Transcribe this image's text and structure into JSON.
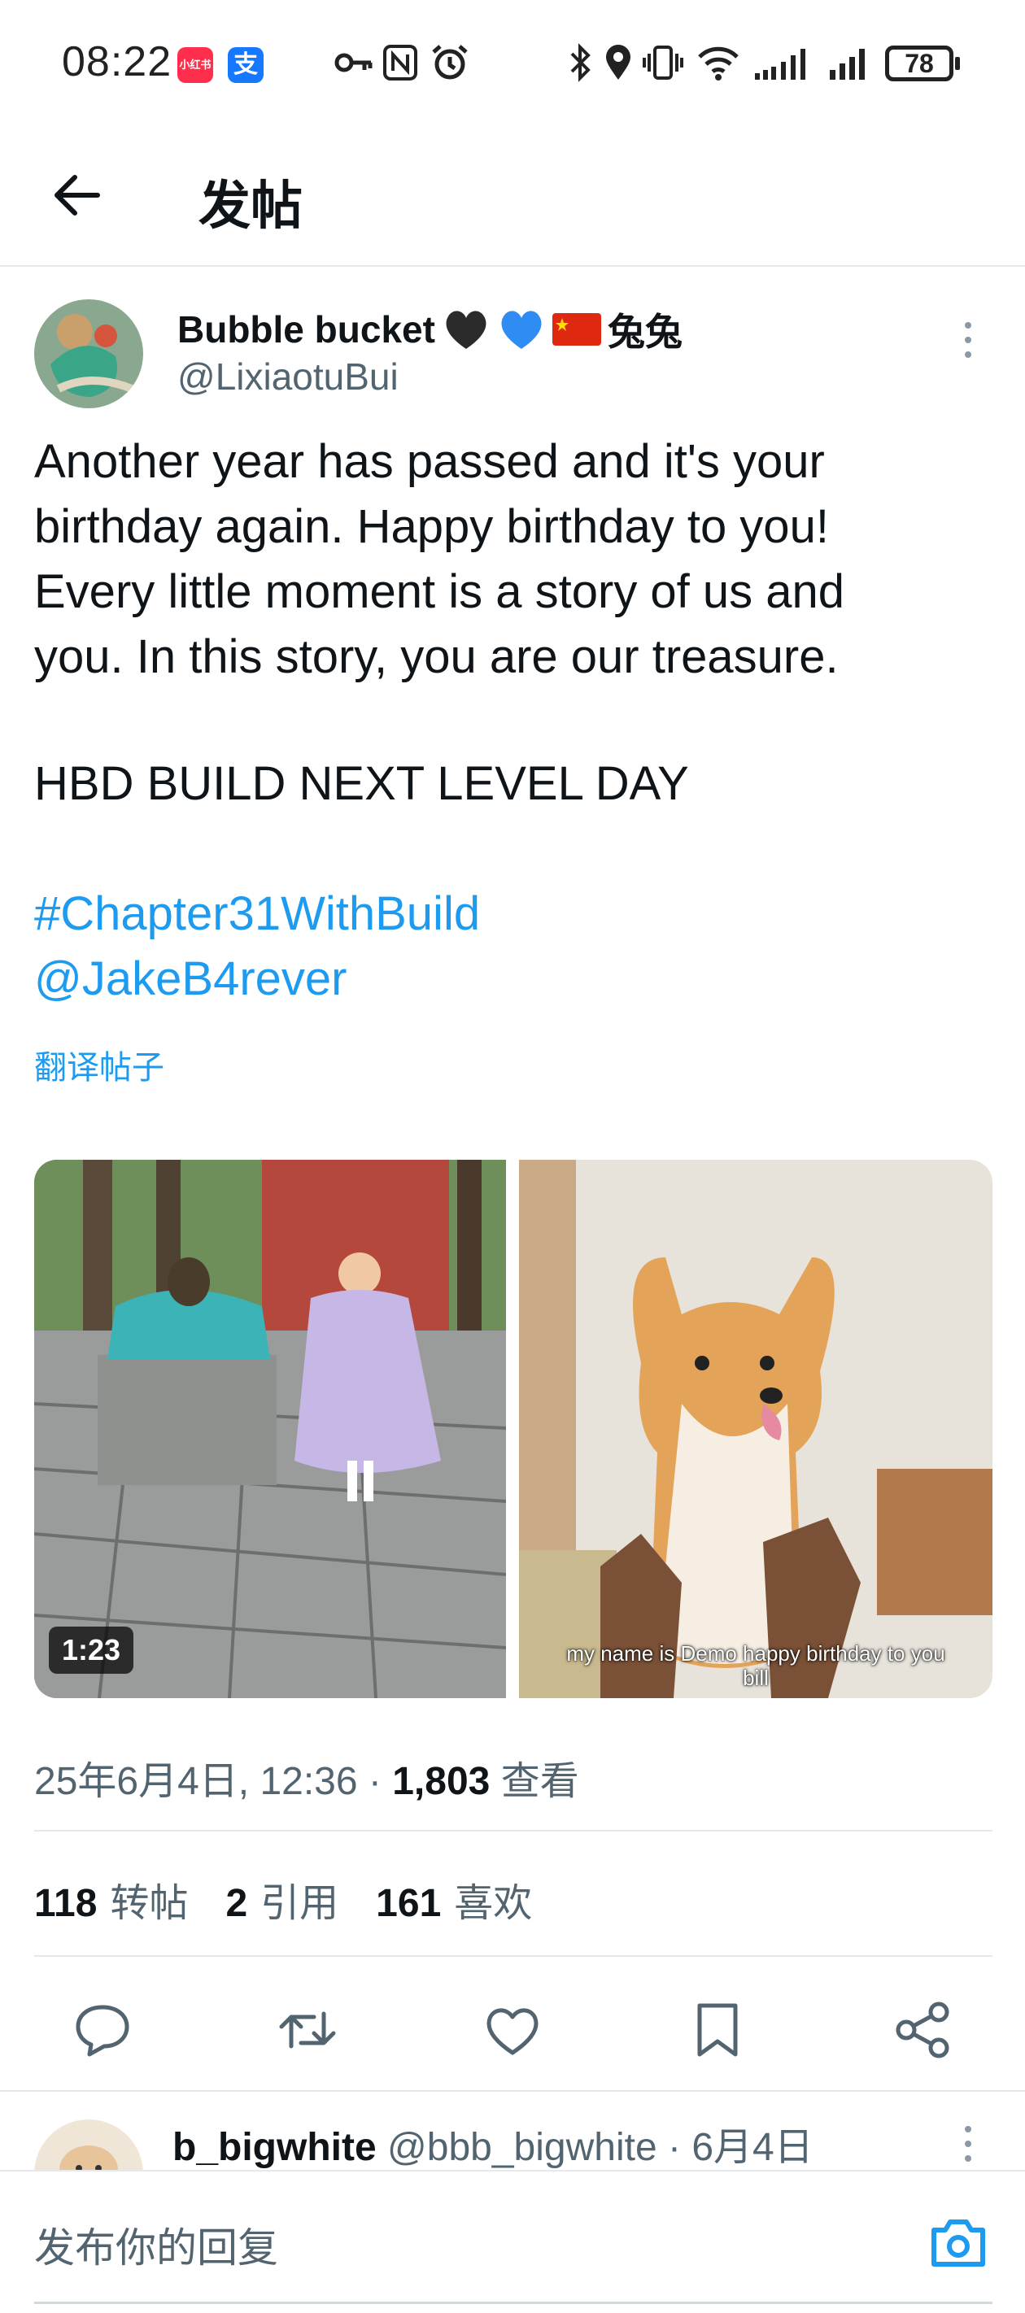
{
  "status_bar": {
    "time": "08:22",
    "app_badge_1": "小红书",
    "app_badge_2": "支",
    "battery": "78",
    "icons": [
      "key-icon",
      "nfc-icon",
      "alarm-icon",
      "bluetooth-icon",
      "location-icon",
      "vibrate-icon",
      "wifi-icon",
      "signal-icon",
      "signal-icon"
    ]
  },
  "header": {
    "title": "发帖"
  },
  "post": {
    "author_name": "Bubble bucket",
    "author_suffix": "兔兔",
    "author_handle": "@LixiaotuBui",
    "text": "Another year has passed and it's your\nbirthday again. Happy birthday to you!\nEvery little moment is a story of us and\nyou. In this story, you are our treasure.",
    "hbd": "HBD BUILD NEXT LEVEL DAY",
    "hashtag": "#Chapter31WithBuild",
    "mention": "@JakeB4rever",
    "translate": "翻译帖子",
    "media": {
      "video_duration": "1:23",
      "caption": "my name is Demo happy birthday to you bill"
    },
    "meta": {
      "date": "25年6月4日, 12:36",
      "sep": " · ",
      "views": "1,803",
      "views_label": "查看"
    },
    "stats": {
      "reposts": "118",
      "reposts_label": "转帖",
      "quotes": "2",
      "quotes_label": "引用",
      "likes": "161",
      "likes_label": "喜欢"
    }
  },
  "reply_preview": {
    "name": "b_bigwhite",
    "handle": "@bbb_bigwhite",
    "date": "6月4日"
  },
  "compose": {
    "placeholder": "发布你的回复"
  },
  "colors": {
    "accent": "#1d9bf0",
    "text": "#0f1419",
    "muted": "#536471"
  }
}
